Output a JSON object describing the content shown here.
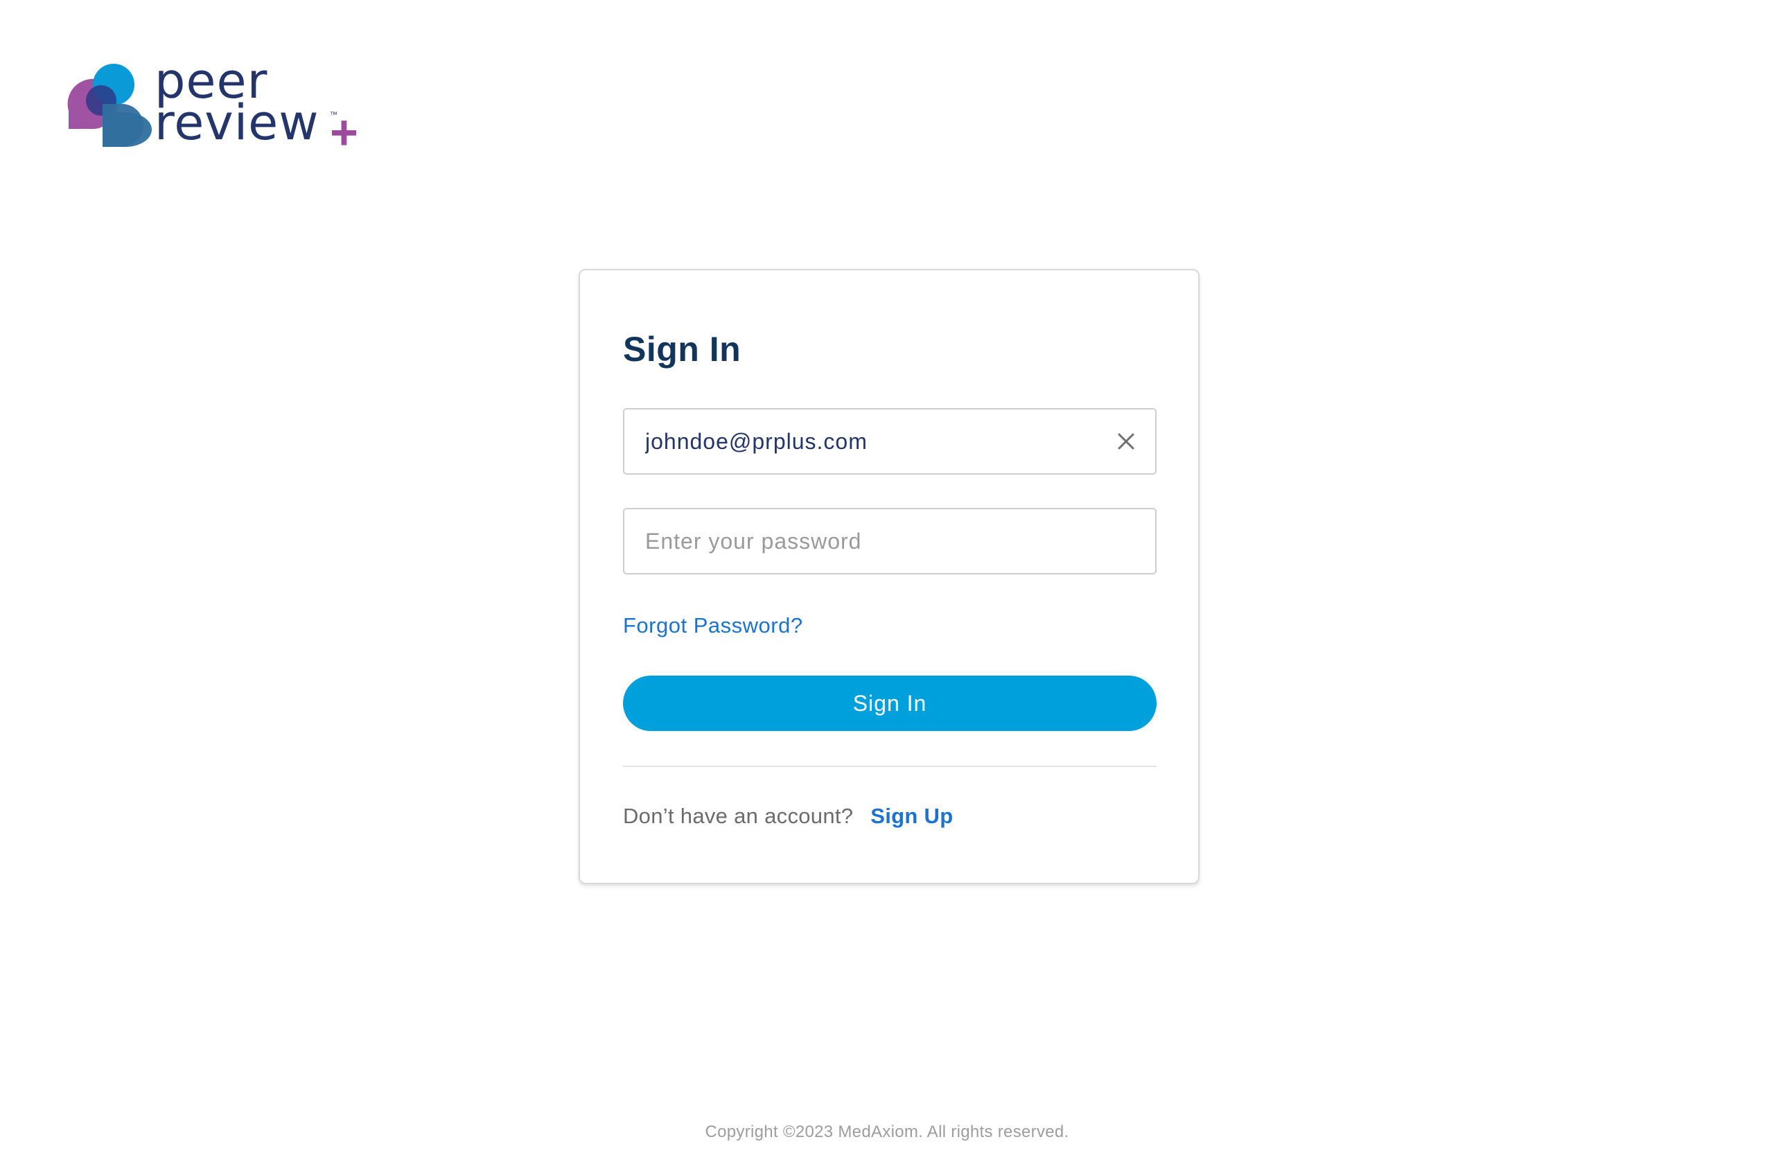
{
  "brand": {
    "logo_line1": "peer",
    "logo_line2": "review",
    "logo_plus": "+",
    "logo_tm": "™",
    "colors": {
      "navy": "#24356b",
      "purple": "#9b4a9e",
      "blue": "#0a9ad8",
      "steel": "#2f6f9e"
    }
  },
  "signin": {
    "title": "Sign In",
    "email": {
      "value": "johndoe@prplus.com",
      "clear_icon": "close-icon"
    },
    "password": {
      "value": "",
      "placeholder": "Enter your password"
    },
    "forgot_label": "Forgot Password?",
    "submit_label": "Sign In",
    "signup_prompt": "Don’t have an account?",
    "signup_label": "Sign Up",
    "accent_color": "#00a0dc",
    "link_color": "#1a73d1",
    "title_color": "#12355b"
  },
  "footer": {
    "copyright": "Copyright ©2023 MedAxiom. All rights reserved."
  }
}
